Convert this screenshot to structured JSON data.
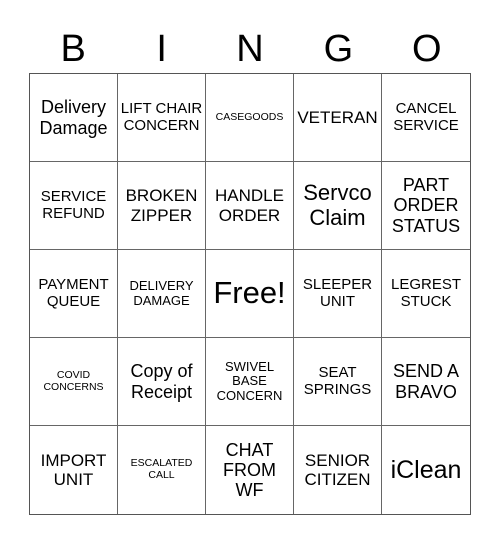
{
  "header": [
    "B",
    "I",
    "N",
    "G",
    "O"
  ],
  "cells": [
    "Delivery Damage",
    "LIFT CHAIR CONCERN",
    "CASEGOODS",
    "VETERAN",
    "CANCEL SERVICE",
    "SERVICE REFUND",
    "BROKEN ZIPPER",
    "HANDLE ORDER",
    "Servco Claim",
    "PART ORDER STATUS",
    "PAYMENT QUEUE",
    "DELIVERY DAMAGE",
    "Free!",
    "SLEEPER UNIT",
    "LEGREST STUCK",
    "COVID CONCERNS",
    "Copy of Receipt",
    "SWIVEL BASE CONCERN",
    "SEAT SPRINGS",
    "SEND A BRAVO",
    "IMPORT UNIT",
    "ESCALATED CALL",
    "CHAT FROM WF",
    "SENIOR CITIZEN",
    "iClean"
  ]
}
